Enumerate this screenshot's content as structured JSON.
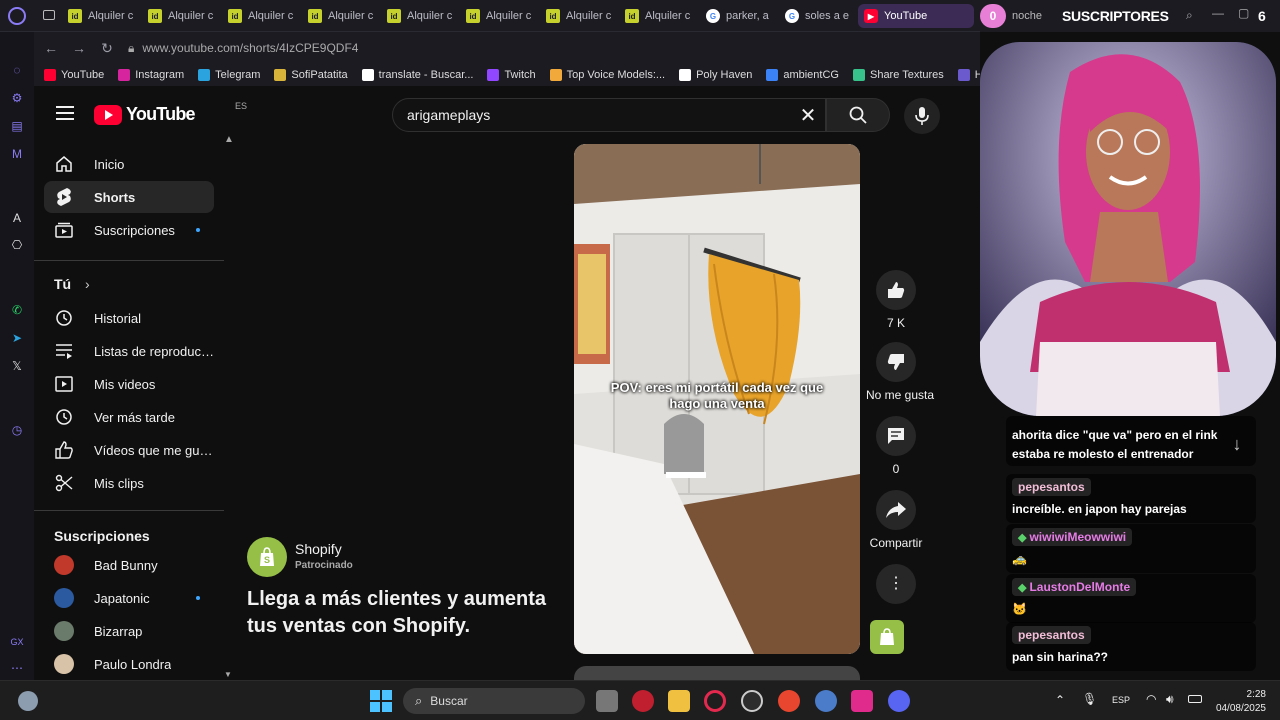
{
  "browser": {
    "tabs": [
      {
        "label": "Alquiler c",
        "favicon": "id"
      },
      {
        "label": "Alquiler c",
        "favicon": "id"
      },
      {
        "label": "Alquiler c",
        "favicon": "id"
      },
      {
        "label": "Alquiler c",
        "favicon": "id"
      },
      {
        "label": "Alquiler c",
        "favicon": "id"
      },
      {
        "label": "Alquiler c",
        "favicon": "id"
      },
      {
        "label": "Alquiler c",
        "favicon": "id"
      },
      {
        "label": "Alquiler c",
        "favicon": "id"
      },
      {
        "label": "parker, a",
        "favicon": "G"
      },
      {
        "label": "soles a e",
        "favicon": "G"
      },
      {
        "label": "YouTube",
        "favicon": "▶"
      }
    ],
    "url": "www.youtube.com/shorts/4IzCPE9QDF4",
    "bookmarks": [
      {
        "label": "YouTube",
        "color": "#ff0033"
      },
      {
        "label": "Instagram",
        "color": "#d6249f"
      },
      {
        "label": "Telegram",
        "color": "#2aa3df"
      },
      {
        "label": "SofiPatatita",
        "color": "#d9b43a"
      },
      {
        "label": "translate - Buscar...",
        "color": "#ffffff"
      },
      {
        "label": "Twitch",
        "color": "#9146ff"
      },
      {
        "label": "Top Voice Models:...",
        "color": "#f2a93b"
      },
      {
        "label": "Poly Haven",
        "color": "#ffffff"
      },
      {
        "label": "ambientCG",
        "color": "#3b82f6"
      },
      {
        "label": "Share Textures",
        "color": "#36c28a"
      },
      {
        "label": "Han",
        "color": "#6a5acd"
      }
    ]
  },
  "youtube": {
    "logo_text": "YouTube",
    "region": "ES",
    "search_value": "arigameplays",
    "sidebar": {
      "main": [
        {
          "label": "Inicio",
          "icon": "home-icon"
        },
        {
          "label": "Shorts",
          "icon": "shorts-icon"
        },
        {
          "label": "Suscripciones",
          "icon": "subscriptions-icon"
        }
      ],
      "you_heading": "Tú",
      "you": [
        {
          "label": "Historial",
          "icon": "history-icon"
        },
        {
          "label": "Listas de reproducc...",
          "icon": "playlist-icon"
        },
        {
          "label": "Mis videos",
          "icon": "my-videos-icon"
        },
        {
          "label": "Ver más tarde",
          "icon": "watch-later-icon"
        },
        {
          "label": "Vídeos que me gus...",
          "icon": "liked-icon"
        },
        {
          "label": "Mis clips",
          "icon": "clips-icon"
        }
      ],
      "subs_heading": "Suscripciones",
      "subs": [
        {
          "label": "Bad Bunny",
          "color": "#c0392b"
        },
        {
          "label": "Japatonic",
          "color": "#2c5aa0"
        },
        {
          "label": "Bizarrap",
          "color": "#6b7b6b"
        },
        {
          "label": "Paulo Londra",
          "color": "#d9c3a8"
        }
      ]
    },
    "ad": {
      "advertiser": "Shopify",
      "sponsored": "Patrocinado",
      "headline": "Llega a más clientes y aumenta tus ventas con Shopify."
    },
    "short": {
      "caption": "POV: eres mi portátil cada vez que hago una venta"
    },
    "actions": {
      "likes": "7 K",
      "dislike": "No me gusta",
      "comments": "0",
      "share": "Compartir"
    }
  },
  "stream_overlay": {
    "subs_count_badge": "0",
    "noche": "noche",
    "subs_label": "SUSCRIPTORES",
    "subs_value": "6",
    "chat": [
      {
        "user": "",
        "text": "ahorita dice \"que va\" pero en el rink estaba re molesto el entrenador"
      },
      {
        "user": "pepesantos",
        "text": "increíble. en japon hay parejas"
      },
      {
        "user": "wiwiwiMeowwiwi",
        "text": "",
        "emote": "🚕"
      },
      {
        "user": "LaustonDelMonte",
        "text": "",
        "emote": "🐱"
      },
      {
        "user": "pepesantos",
        "text": "pan sin harina??"
      }
    ]
  },
  "taskbar": {
    "search_placeholder": "Buscar",
    "lang": "ESP",
    "time": "2:28",
    "date": "04/08/2025"
  }
}
